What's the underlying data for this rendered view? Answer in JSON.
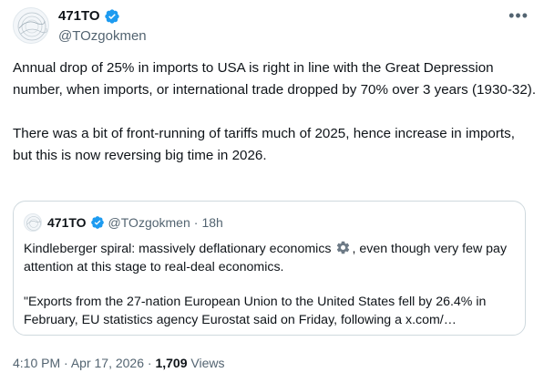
{
  "author": {
    "display_name": "471TO",
    "handle": "@TOzgokmen"
  },
  "more_icon": "more-horizontal-icon",
  "verified_color": "#1d9bf0",
  "tweet": {
    "paragraphs": [
      "Annual drop of 25% in imports to USA is right in line with the Great Depression number, when imports, or international trade dropped by 70% over 3 years (1930-32).",
      "There was a bit of front-running of tariffs much of 2025, hence increase in imports, but this is now reversing big time in 2026."
    ]
  },
  "quote": {
    "display_name": "471TO",
    "handle": "@TOzgokmen",
    "separator": "·",
    "time": "18h",
    "line1_before_icon": "Kindleberger spiral: massively deflationary economics",
    "gear_icon": "gear-emoji-icon",
    "line1_after_icon": ", even though very few pay attention at this stage to real-deal economics.",
    "paragraph2": "\"Exports from the 27-nation European Union to the United States fell by 26.4% in February, EU statistics agency Eurostat said on Friday, following a x.com/…"
  },
  "meta": {
    "time": "4:10 PM",
    "separator": "·",
    "date": "Apr 17, 2026",
    "views_count": "1,709",
    "views_label": "Views"
  }
}
